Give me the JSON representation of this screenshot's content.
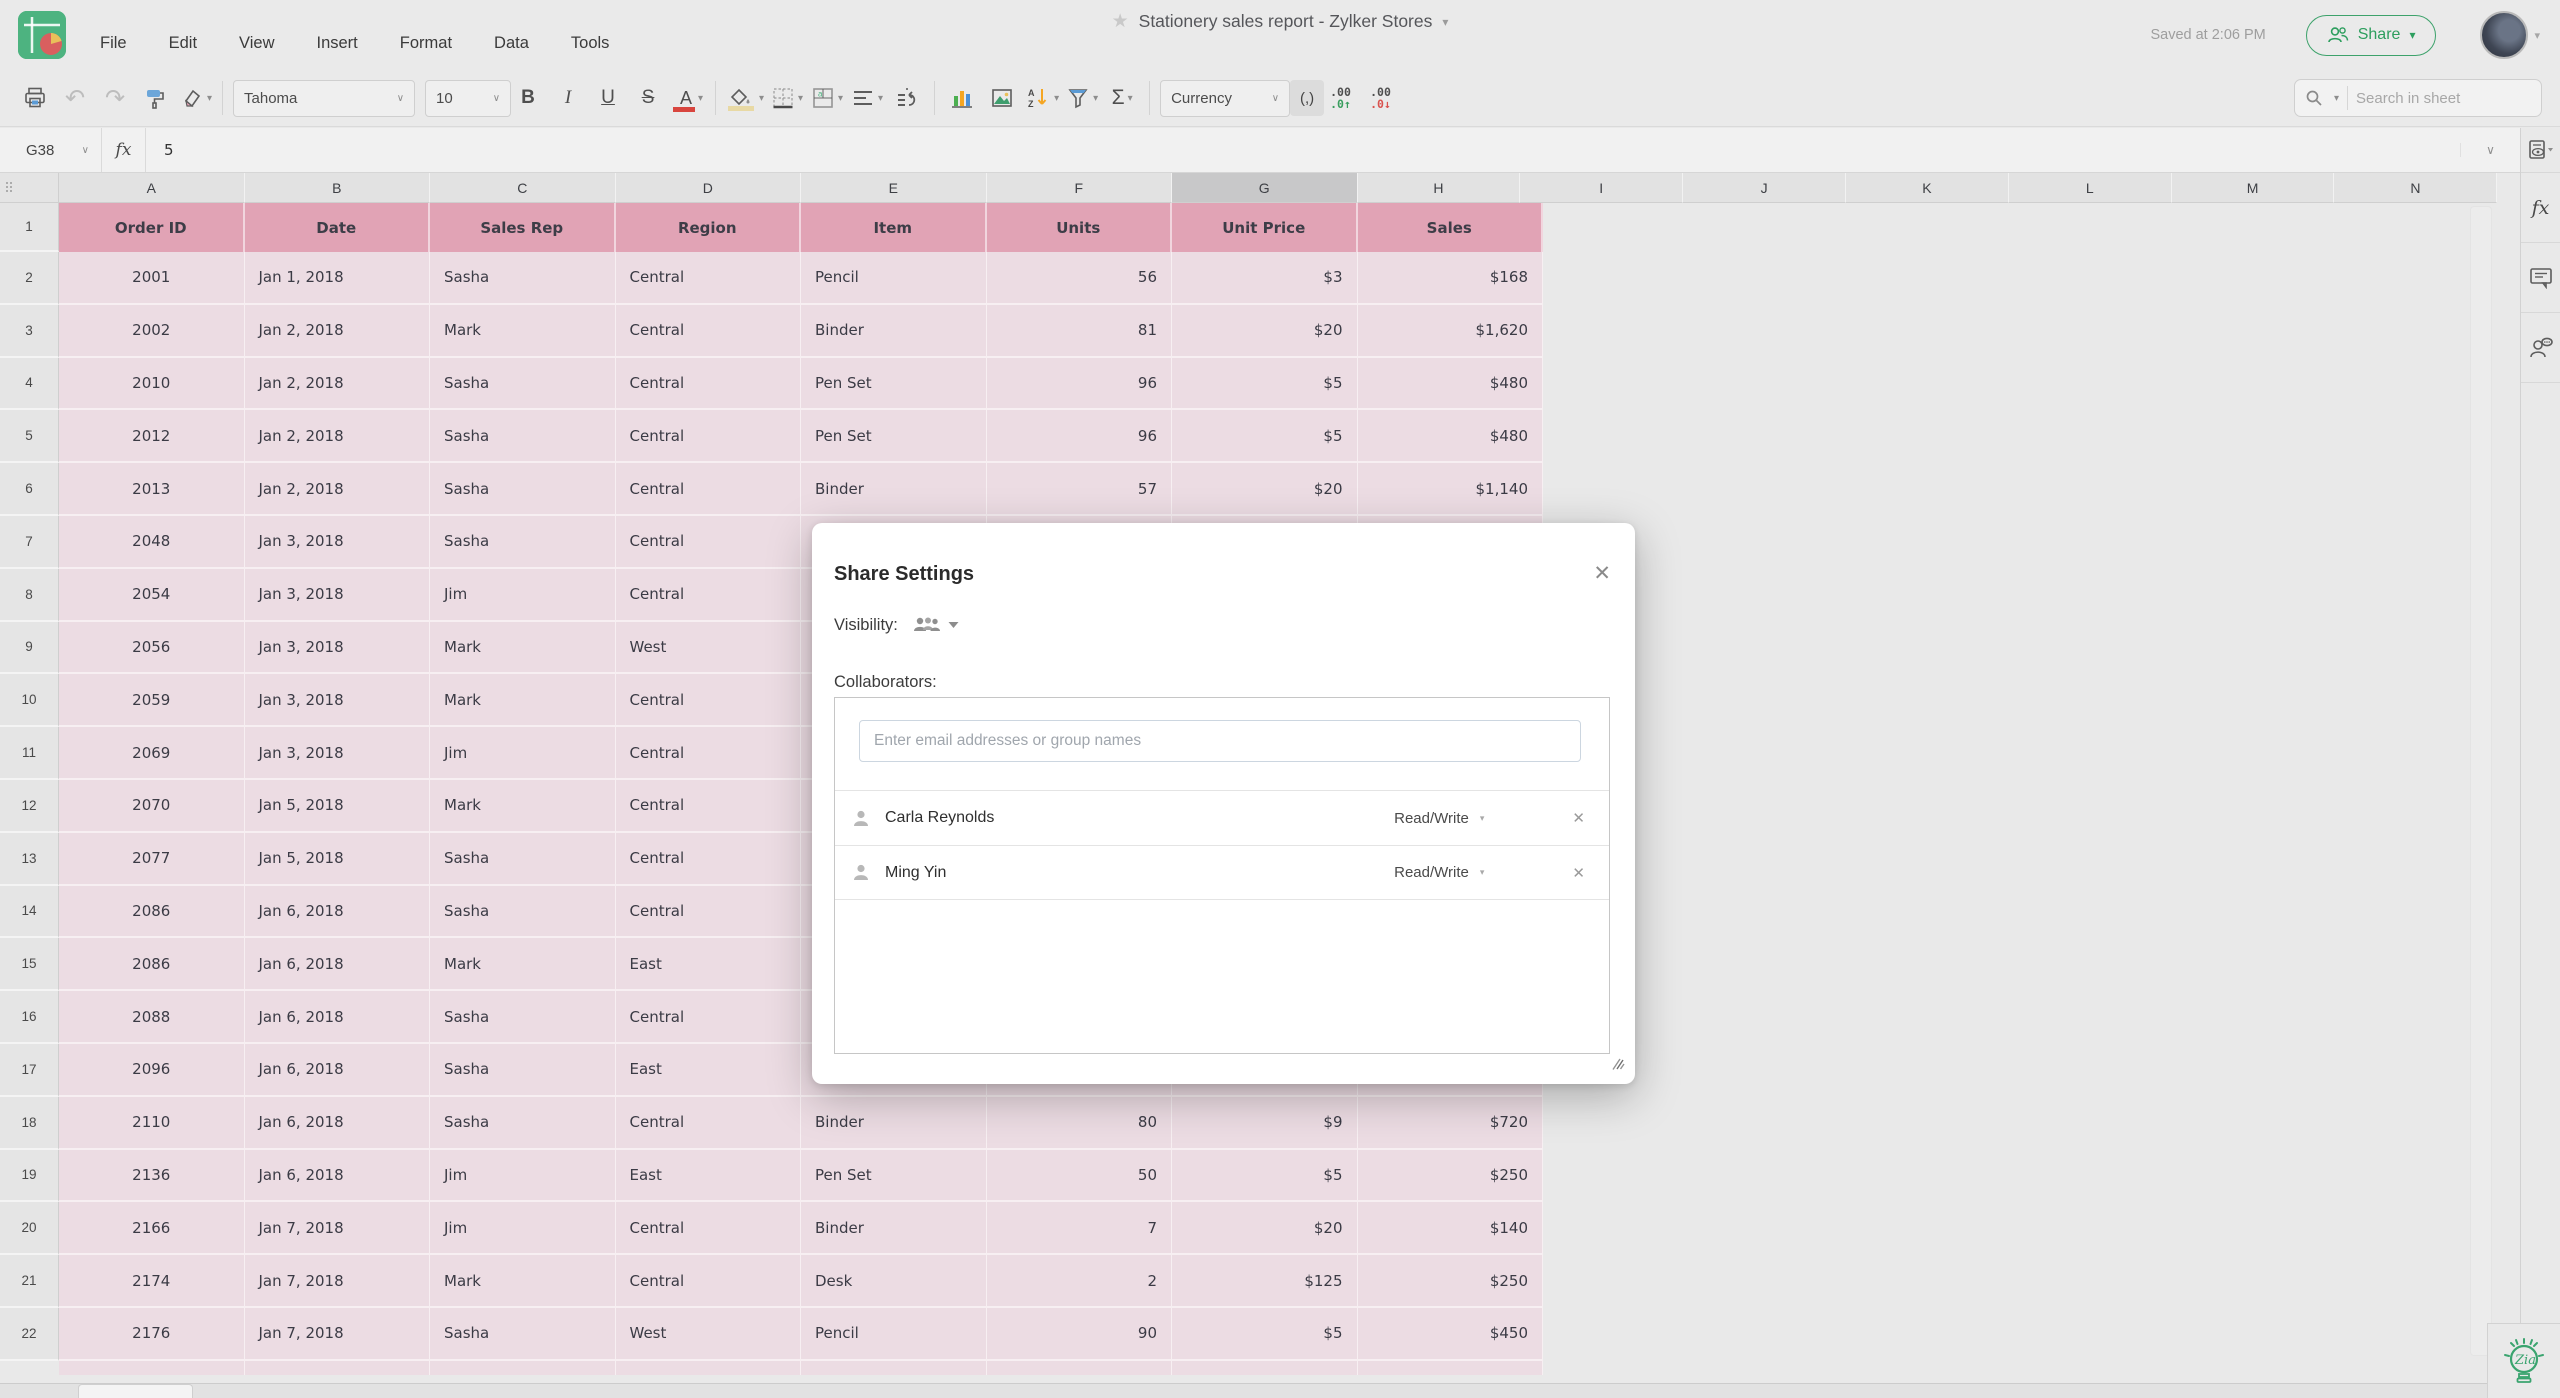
{
  "app": {
    "menus": [
      "File",
      "Edit",
      "View",
      "Insert",
      "Format",
      "Data",
      "Tools"
    ],
    "title": "Stationery sales report - Zylker Stores",
    "saved_status": "Saved at 2:06 PM",
    "share_label": "Share"
  },
  "icons": {
    "chevron": "▾",
    "star": "★",
    "undo": "↶",
    "redo": "↷",
    "close": "✕",
    "sigma": "Σ"
  },
  "toolbar": {
    "font_name": "Tahoma",
    "font_size": "10",
    "bold": "B",
    "italic": "I",
    "underline": "U",
    "strikethrough": "S",
    "font_color": "A",
    "sort_a": "A",
    "sort_z": "Z",
    "number_format": "Currency",
    "comma": "(,)",
    "inc_decimal_top": ".00",
    "inc_decimal_bottom": ".0↑",
    "dec_decimal_top": ".00",
    "dec_decimal_bottom": ".0↓",
    "search_placeholder": "Search in sheet"
  },
  "formula_bar": {
    "cell_ref": "G38",
    "fx": "fx",
    "value": "5"
  },
  "grid": {
    "selected_column": "G",
    "columns": [
      {
        "label": "A"
      },
      {
        "label": "B"
      },
      {
        "label": "C"
      },
      {
        "label": "D"
      },
      {
        "label": "E"
      },
      {
        "label": "F"
      },
      {
        "label": "G",
        "state": "selected"
      },
      {
        "label": "H"
      },
      {
        "label": "I"
      },
      {
        "label": "J"
      },
      {
        "label": "K"
      },
      {
        "label": "L"
      },
      {
        "label": "M"
      },
      {
        "label": "N"
      }
    ],
    "header_row": {
      "number": "1",
      "cells": [
        "Order ID",
        "Date",
        "Sales Rep",
        "Region",
        "Item",
        "Units",
        "Unit Price",
        "Sales"
      ]
    },
    "rows": [
      {
        "n": "2",
        "cells": [
          "2001",
          "Jan 1, 2018",
          "Sasha",
          "Central",
          "Pencil",
          "56",
          "$3",
          "$168"
        ]
      },
      {
        "n": "3",
        "cells": [
          "2002",
          "Jan 2, 2018",
          "Mark",
          "Central",
          "Binder",
          "81",
          "$20",
          "$1,620"
        ]
      },
      {
        "n": "4",
        "cells": [
          "2010",
          "Jan 2, 2018",
          "Sasha",
          "Central",
          "Pen Set",
          "96",
          "$5",
          "$480"
        ]
      },
      {
        "n": "5",
        "cells": [
          "2012",
          "Jan 2, 2018",
          "Sasha",
          "Central",
          "Pen Set",
          "96",
          "$5",
          "$480"
        ]
      },
      {
        "n": "6",
        "cells": [
          "2013",
          "Jan 2, 2018",
          "Sasha",
          "Central",
          "Binder",
          "57",
          "$20",
          "$1,140"
        ]
      },
      {
        "n": "7",
        "cells": [
          "2048",
          "Jan 3, 2018",
          "Sasha",
          "Central",
          "",
          "",
          "",
          ""
        ]
      },
      {
        "n": "8",
        "cells": [
          "2054",
          "Jan 3, 2018",
          "Jim",
          "Central",
          "",
          "",
          "",
          ""
        ]
      },
      {
        "n": "9",
        "cells": [
          "2056",
          "Jan 3, 2018",
          "Mark",
          "West",
          "",
          "",
          "",
          ""
        ]
      },
      {
        "n": "10",
        "cells": [
          "2059",
          "Jan 3, 2018",
          "Mark",
          "Central",
          "",
          "",
          "",
          ""
        ]
      },
      {
        "n": "11",
        "cells": [
          "2069",
          "Jan 3, 2018",
          "Jim",
          "Central",
          "",
          "",
          "",
          ""
        ]
      },
      {
        "n": "12",
        "cells": [
          "2070",
          "Jan 5, 2018",
          "Mark",
          "Central",
          "",
          "",
          "",
          ""
        ]
      },
      {
        "n": "13",
        "cells": [
          "2077",
          "Jan 5, 2018",
          "Sasha",
          "Central",
          "",
          "",
          "",
          ""
        ]
      },
      {
        "n": "14",
        "cells": [
          "2086",
          "Jan 6, 2018",
          "Sasha",
          "Central",
          "",
          "",
          "",
          ""
        ]
      },
      {
        "n": "15",
        "cells": [
          "2086",
          "Jan 6, 2018",
          "Mark",
          "East",
          "",
          "",
          "",
          ""
        ]
      },
      {
        "n": "16",
        "cells": [
          "2088",
          "Jan 6, 2018",
          "Sasha",
          "Central",
          "",
          "",
          "",
          ""
        ]
      },
      {
        "n": "17",
        "cells": [
          "2096",
          "Jan 6, 2018",
          "Sasha",
          "East",
          "",
          "",
          "",
          ""
        ]
      },
      {
        "n": "18",
        "cells": [
          "2110",
          "Jan 6, 2018",
          "Sasha",
          "Central",
          "Binder",
          "80",
          "$9",
          "$720"
        ]
      },
      {
        "n": "19",
        "cells": [
          "2136",
          "Jan 6, 2018",
          "Jim",
          "East",
          "Pen Set",
          "50",
          "$5",
          "$250"
        ]
      },
      {
        "n": "20",
        "cells": [
          "2166",
          "Jan 7, 2018",
          "Jim",
          "Central",
          "Binder",
          "7",
          "$20",
          "$140"
        ]
      },
      {
        "n": "21",
        "cells": [
          "2174",
          "Jan 7, 2018",
          "Mark",
          "Central",
          "Desk",
          "2",
          "$125",
          "$250"
        ]
      },
      {
        "n": "22",
        "cells": [
          "2176",
          "Jan 7, 2018",
          "Sasha",
          "West",
          "Pencil",
          "90",
          "$5",
          "$450"
        ]
      }
    ]
  },
  "sidebar": {
    "fx_label": "fx"
  },
  "zia": {
    "label": "Zia"
  },
  "dialog": {
    "title": "Share Settings",
    "visibility_label": "Visibility:",
    "collaborators_label": "Collaborators:",
    "input_placeholder": "Enter email addresses or group names",
    "collaborators": [
      {
        "name": "Carla Reynolds",
        "permission": "Read/Write"
      },
      {
        "name": "Ming Yin",
        "permission": "Read/Write"
      }
    ]
  }
}
